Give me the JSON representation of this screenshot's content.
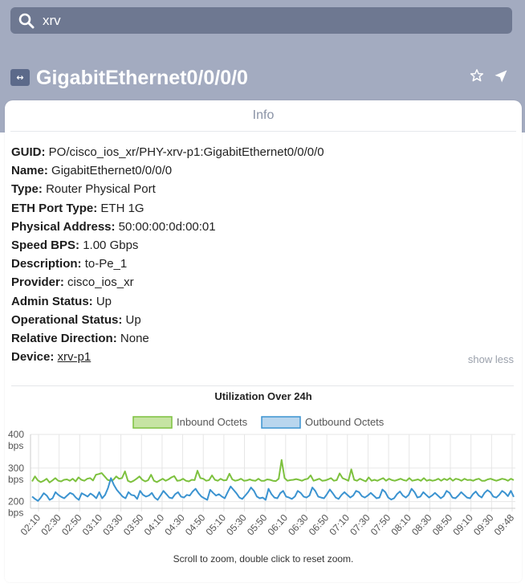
{
  "search": {
    "value": "xrv",
    "icon": "search-icon"
  },
  "header": {
    "title": "GigabitEthernet0/0/0/0",
    "port_icon_glyph": "↔",
    "icons": [
      "port-icon",
      "star-icon",
      "navigate-icon"
    ]
  },
  "tabs": [
    {
      "label": "Info"
    }
  ],
  "details": [
    {
      "label": "GUID:",
      "value": "PO/cisco_ios_xr/PHY-xrv-p1:GigabitEthernet0/0/0/0"
    },
    {
      "label": "Name:",
      "value": "GigabitEthernet0/0/0/0"
    },
    {
      "label": "Type:",
      "value": "Router Physical Port"
    },
    {
      "label": "ETH Port Type:",
      "value": "ETH 1G"
    },
    {
      "label": "Physical Address:",
      "value": "50:00:00:0d:00:01"
    },
    {
      "label": "Speed BPS:",
      "value": "1.00 Gbps"
    },
    {
      "label": "Description:",
      "value": "to-Pe_1"
    },
    {
      "label": "Provider:",
      "value": "cisco_ios_xr"
    },
    {
      "label": "Admin Status:",
      "value": "Up"
    },
    {
      "label": "Operational Status:",
      "value": "Up"
    },
    {
      "label": "Relative Direction:",
      "value": "None"
    },
    {
      "label": "Device:",
      "value": "xrv-p1"
    }
  ],
  "show_less": "show less",
  "chart_hint": "Scroll to zoom, double click to reset zoom.",
  "colors": {
    "inbound": "#7dc13e",
    "outbound": "#3b93d0",
    "header_bg": "#a3abc0"
  },
  "chart_data": {
    "type": "line",
    "title": "Utilization Over 24h",
    "xlabel": "",
    "ylabel": "",
    "grid": true,
    "legend": "top-center",
    "y_ticks": [
      {
        "value": 200,
        "label": "200",
        "unit": "bps"
      },
      {
        "value": 300,
        "label": "300",
        "unit": "bps"
      },
      {
        "value": 400,
        "label": "400",
        "unit": "bps"
      }
    ],
    "ylim": [
      180,
      400
    ],
    "categories": [
      "02:10",
      "02:30",
      "02:50",
      "03:10",
      "03:30",
      "03:50",
      "04:10",
      "04:30",
      "04:50",
      "05:10",
      "05:30",
      "05:50",
      "06:10",
      "06:30",
      "06:50",
      "07:10",
      "07:30",
      "07:50",
      "08:10",
      "08:30",
      "08:50",
      "09:10",
      "09:30",
      "09:48"
    ],
    "series": [
      {
        "name": "Inbound Octets",
        "values": [
          260,
          275,
          263,
          258,
          262,
          268,
          257,
          263,
          270,
          262,
          260,
          265,
          266,
          262,
          268,
          260,
          272,
          265,
          262,
          268,
          270,
          263,
          280,
          282,
          285,
          275,
          265,
          262,
          265,
          275,
          268,
          270,
          290,
          262,
          258,
          262,
          268,
          275,
          265,
          260,
          264,
          280,
          262,
          258,
          263,
          268,
          262,
          266,
          272,
          276,
          262,
          263,
          268,
          262,
          260,
          265,
          264,
          292,
          270,
          268,
          262,
          264,
          278,
          265,
          262,
          268,
          263,
          264,
          283,
          266,
          262,
          264,
          268,
          262,
          263,
          266,
          263,
          262,
          268,
          262,
          262,
          266,
          265,
          262,
          261,
          268,
          324,
          270,
          262,
          264,
          265,
          267,
          265,
          262,
          266,
          268,
          278,
          262,
          265,
          268,
          262,
          263,
          266,
          270,
          262,
          264,
          284,
          270,
          266,
          262,
          296,
          265,
          262,
          268,
          264,
          260,
          272,
          262,
          265,
          262,
          266,
          270,
          262,
          268,
          264,
          262,
          265,
          268,
          264,
          262,
          270,
          262,
          264,
          266,
          262,
          270,
          262,
          265,
          262,
          264,
          268,
          262,
          268,
          264,
          270,
          262,
          268,
          266,
          262,
          268,
          264,
          265,
          262,
          266,
          268,
          262,
          262,
          266,
          268,
          265,
          262,
          265,
          268,
          266,
          262,
          268,
          264
        ]
      },
      {
        "name": "Outbound Octets",
        "values": [
          215,
          208,
          202,
          212,
          225,
          218,
          205,
          210,
          228,
          220,
          214,
          210,
          218,
          226,
          222,
          212,
          205,
          225,
          220,
          215,
          224,
          218,
          210,
          228,
          210,
          220,
          240,
          270,
          250,
          235,
          225,
          215,
          210,
          228,
          220,
          218,
          208,
          232,
          220,
          215,
          218,
          226,
          212,
          205,
          218,
          232,
          222,
          212,
          210,
          222,
          228,
          215,
          212,
          220,
          218,
          230,
          238,
          225,
          215,
          210,
          205,
          235,
          226,
          218,
          222,
          215,
          210,
          228,
          245,
          235,
          225,
          212,
          208,
          218,
          228,
          242,
          232,
          215,
          210,
          212,
          205,
          238,
          222,
          212,
          210,
          225,
          232,
          215,
          212,
          208,
          215,
          232,
          226,
          215,
          212,
          218,
          242,
          232,
          215,
          212,
          210,
          222,
          236,
          225,
          212,
          208,
          220,
          228,
          220,
          212,
          218,
          232,
          228,
          216,
          212,
          218,
          226,
          218,
          210,
          212,
          236,
          228,
          212,
          206,
          210,
          222,
          230,
          218,
          212,
          220,
          238,
          228,
          212,
          215,
          228,
          220,
          212,
          218,
          226,
          218,
          210,
          216,
          232,
          226,
          212,
          210,
          218,
          228,
          220,
          212,
          210,
          222,
          230,
          218,
          212,
          226,
          234,
          228,
          215,
          212,
          220,
          232,
          226,
          216,
          232,
          214
        ]
      }
    ]
  }
}
